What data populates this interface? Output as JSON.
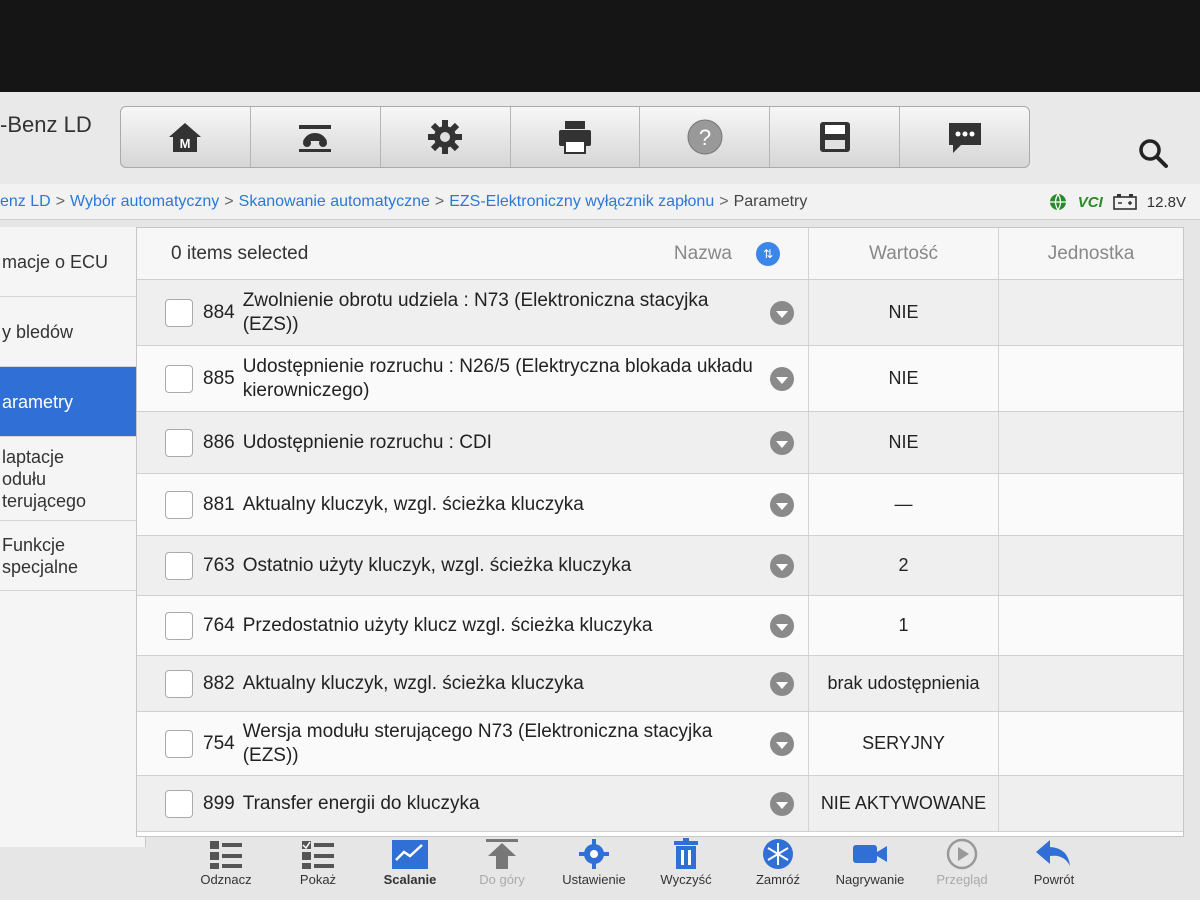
{
  "app": {
    "title": "-Benz LD"
  },
  "toolbar": {
    "buttons": [
      "home-icon",
      "vehicle-lift-icon",
      "gear-icon",
      "printer-icon",
      "help-icon",
      "save-icon",
      "chat-icon"
    ],
    "home_label": "M"
  },
  "breadcrumb": {
    "items": [
      "enz LD",
      "Wybór automatyczny",
      "Skanowanie automatyczne",
      "EZS-Elektroniczny wyłącznik zapłonu",
      "Parametry"
    ],
    "separator": ">"
  },
  "status": {
    "vci": "VCI",
    "voltage": "12.8V"
  },
  "sidebar": {
    "items": [
      {
        "label": "macje o ECU"
      },
      {
        "label": "y bledów"
      },
      {
        "label": "arametry"
      },
      {
        "label": "laptacje\nodułu\nterującego"
      },
      {
        "label": "Funkcje specjalne"
      }
    ],
    "collapse_label": "❮"
  },
  "table": {
    "selected_text": "0 items selected",
    "headers": {
      "name": "Nazwa",
      "value": "Wartość",
      "unit": "Jednostka"
    },
    "rows": [
      {
        "id": "884",
        "name": "Zwolnienie obrotu udziela : N73 (Elektroniczna stacyjka (EZS))",
        "value": "NIE",
        "unit": ""
      },
      {
        "id": "885",
        "name": "Udostępnienie rozruchu : N26/5 (Elektryczna blokada układu kierowniczego)",
        "value": "NIE",
        "unit": ""
      },
      {
        "id": "886",
        "name": "Udostępnienie rozruchu : CDI",
        "value": "NIE",
        "unit": ""
      },
      {
        "id": "881",
        "name": "Aktualny kluczyk, wzgl. ścieżka kluczyka",
        "value": "—",
        "unit": ""
      },
      {
        "id": "763",
        "name": "Ostatnio użyty kluczyk, wzgl. ścieżka kluczyka",
        "value": "2",
        "unit": ""
      },
      {
        "id": "764",
        "name": "Przedostatnio użyty klucz wzgl. ścieżka kluczyka",
        "value": "1",
        "unit": ""
      },
      {
        "id": "882",
        "name": "Aktualny kluczyk, wzgl. ścieżka kluczyka",
        "value": "brak udostępnienia",
        "unit": ""
      },
      {
        "id": "754",
        "name": "Wersja modułu sterującego N73 (Elektroniczna stacyjka (EZS))",
        "value": "SERYJNY",
        "unit": ""
      },
      {
        "id": "899",
        "name": "Transfer energii do kluczyka",
        "value": "NIE AKTYWOWANE",
        "unit": ""
      }
    ]
  },
  "bottombar": {
    "buttons": [
      {
        "label": "Odznacz",
        "icon": "deselect-icon"
      },
      {
        "label": "Pokaż",
        "icon": "show-list-icon"
      },
      {
        "label": "Scalanie",
        "icon": "graph-icon"
      },
      {
        "label": "Do góry",
        "icon": "arrow-up-icon"
      },
      {
        "label": "Ustawienie",
        "icon": "settings-icon"
      },
      {
        "label": "Wyczyść",
        "icon": "trash-icon"
      },
      {
        "label": "Zamróź",
        "icon": "snowflake-icon"
      },
      {
        "label": "Nagrywanie",
        "icon": "video-icon"
      },
      {
        "label": "Przegląd",
        "icon": "play-icon"
      },
      {
        "label": "Powrót",
        "icon": "return-icon"
      }
    ]
  },
  "colors": {
    "accent": "#2f6fd6",
    "link": "#2b78d8",
    "vci": "#2a8a2a"
  }
}
